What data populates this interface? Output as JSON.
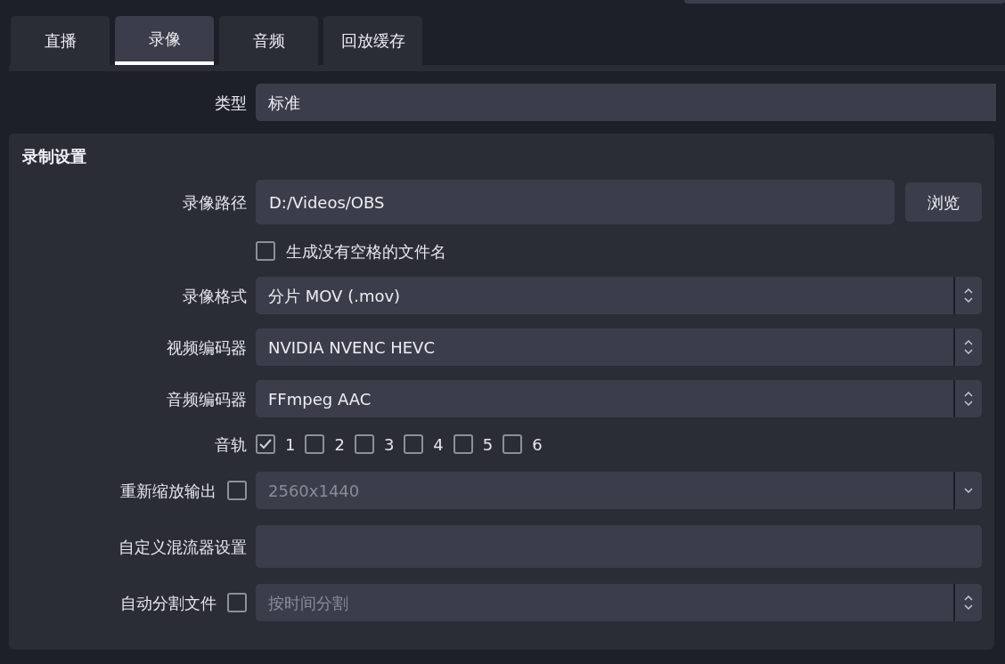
{
  "tabs": [
    {
      "label": "直播",
      "selected": false
    },
    {
      "label": "录像",
      "selected": true
    },
    {
      "label": "音频",
      "selected": false
    },
    {
      "label": "回放缓存",
      "selected": false
    }
  ],
  "type_row": {
    "label": "类型",
    "value": "标准"
  },
  "group": {
    "title": "录制设置",
    "rows": [
      {
        "kind": "path",
        "label": "录像路径",
        "value": "D:/Videos/OBS",
        "button": "浏览"
      },
      {
        "kind": "checkbox",
        "text": "生成没有空格的文件名",
        "checked": false
      },
      {
        "kind": "combo",
        "label": "录像格式",
        "value": "分片 MOV (.mov)",
        "disabled": false
      },
      {
        "kind": "combo",
        "label": "视频编码器",
        "value": "NVIDIA NVENC HEVC",
        "disabled": false
      },
      {
        "kind": "combo",
        "label": "音频编码器",
        "value": "FFmpeg AAC",
        "disabled": false
      },
      {
        "kind": "tracks",
        "label": "音轨",
        "tracks": [
          {
            "label": "1",
            "checked": true
          },
          {
            "label": "2",
            "checked": false
          },
          {
            "label": "3",
            "checked": false
          },
          {
            "label": "4",
            "checked": false
          },
          {
            "label": "5",
            "checked": false
          },
          {
            "label": "6",
            "checked": false
          }
        ]
      },
      {
        "kind": "checkdropdown",
        "label": "重新缩放输出",
        "checked": false,
        "value": "2560x1440",
        "disabled": true
      },
      {
        "kind": "text",
        "label": "自定义混流器设置"
      },
      {
        "kind": "checkcombo",
        "label": "自动分割文件",
        "checked": false,
        "value": "按时间分割",
        "disabled": true
      }
    ]
  }
}
